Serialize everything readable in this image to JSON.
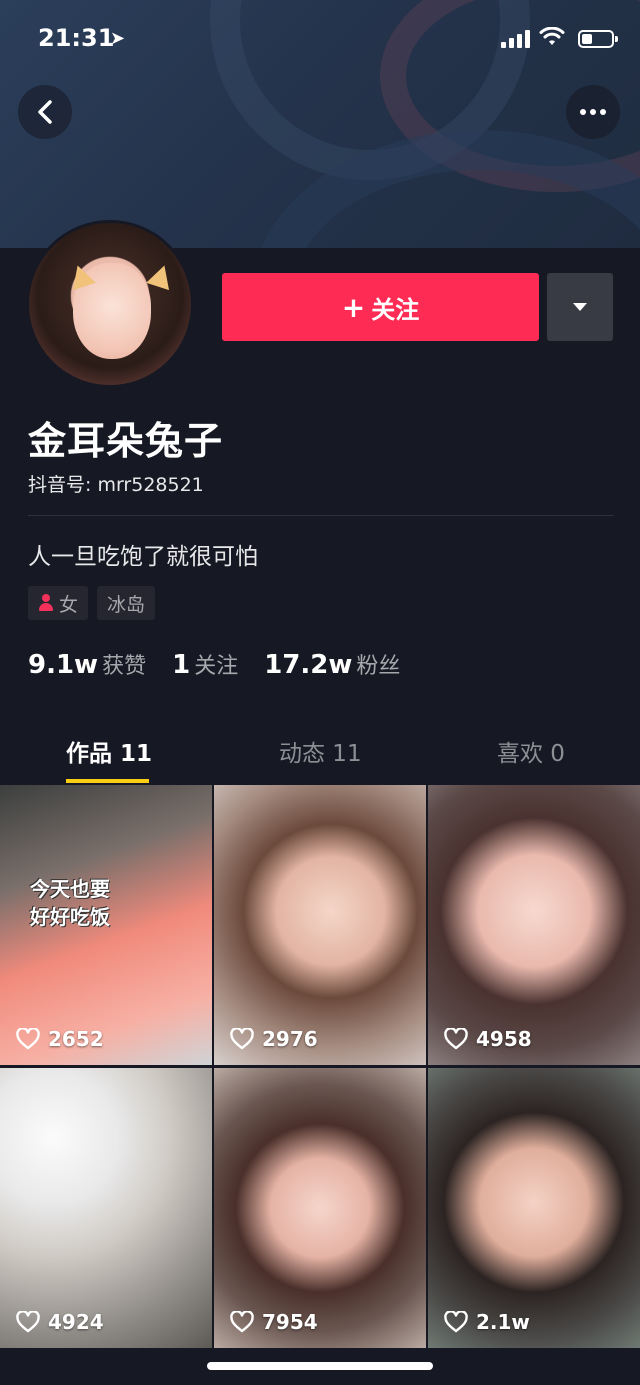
{
  "status_bar": {
    "time": "21:31"
  },
  "profile": {
    "name": "金耳朵兔子",
    "douyin_id": "抖音号: mrr528521",
    "bio": "人一旦吃饱了就很可怕",
    "gender_tag": "女",
    "location_tag": "冰岛"
  },
  "actions": {
    "follow_label": "关注",
    "follow_plus": "+"
  },
  "stats": {
    "likes_value": "9.1w",
    "likes_label": "获赞",
    "following_value": "1",
    "following_label": "关注",
    "fans_value": "17.2w",
    "fans_label": "粉丝"
  },
  "tabs": [
    {
      "label": "作品 11"
    },
    {
      "label": "动态 11"
    },
    {
      "label": "喜欢 0"
    }
  ],
  "videos": [
    {
      "likes": "2652",
      "overlay": "今天也要\n好好吃饭"
    },
    {
      "likes": "2976"
    },
    {
      "likes": "4958"
    },
    {
      "likes": "4924"
    },
    {
      "likes": "7954"
    },
    {
      "likes": "2.1w"
    }
  ],
  "colors": {
    "accent": "#fe2c55",
    "background": "#161823",
    "tab_indicator": "#face15"
  }
}
